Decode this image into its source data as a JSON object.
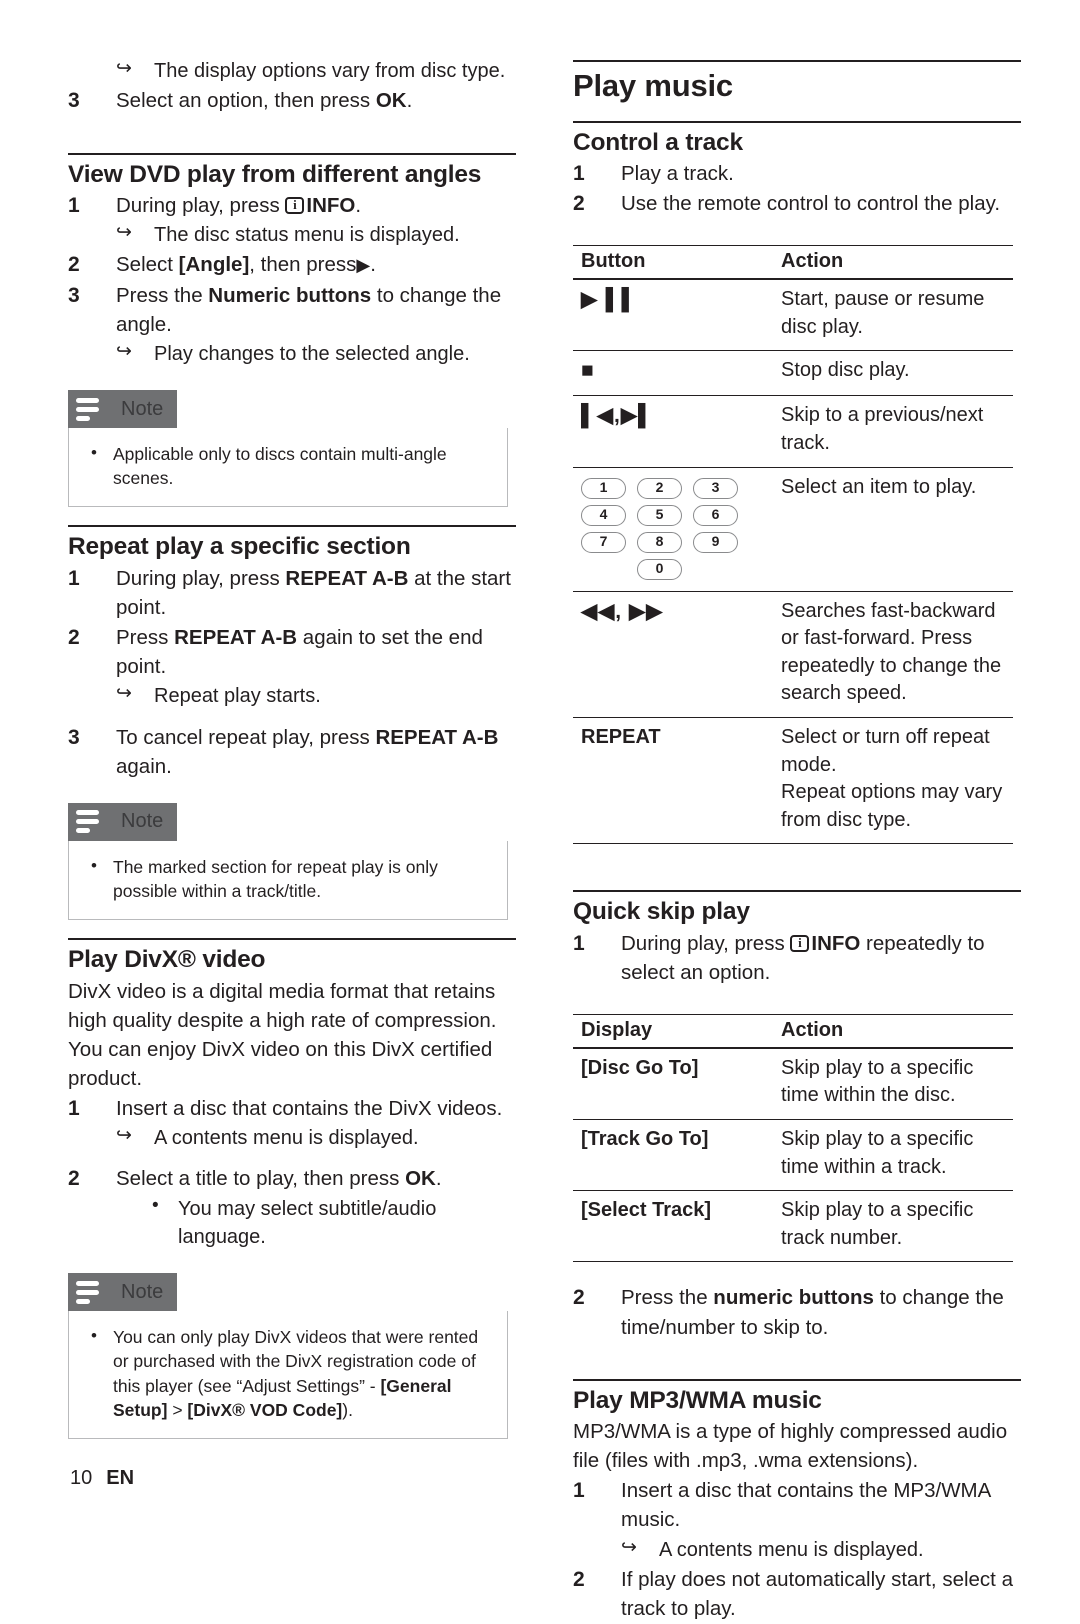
{
  "page": {
    "number": "10",
    "language": "EN"
  },
  "left_column": {
    "carryover": {
      "arrow_note": "The display options vary from disc type.",
      "step3_num": "3",
      "step3_pre": "Select an option, then press ",
      "step3_bold": "OK",
      "step3_post": "."
    },
    "section_angles": {
      "heading": "View DVD play from different angles",
      "step1_num": "1",
      "step1_pre": "During play, press ",
      "step1_bold": "INFO",
      "step1_post": ".",
      "step1_arrow": "The disc status menu is displayed.",
      "step2_num": "2",
      "step2_pre": "Select ",
      "step2_bold": "[Angle]",
      "step2_post": ", then press",
      "step2_glyph": "▶",
      "step2_end": ".",
      "step3_num": "3",
      "step3_pre": "Press the ",
      "step3_bold": "Numeric buttons",
      "step3_post": " to change the angle.",
      "step3_arrow": "Play changes to the selected angle."
    },
    "note1": {
      "title": "Note",
      "items": [
        "Applicable only to discs contain multi-angle scenes."
      ]
    },
    "section_repeat": {
      "heading": "Repeat play a specific section",
      "step1_num": "1",
      "step1_pre": "During play, press ",
      "step1_bold": "REPEAT A-B",
      "step1_post": " at the start point.",
      "step2_num": "2",
      "step2_pre": "Press ",
      "step2_bold": "REPEAT A-B",
      "step2_post": " again to set the end point.",
      "step2_arrow": "Repeat play starts.",
      "step3_num": "3",
      "step3_pre": "To cancel repeat play, press ",
      "step3_bold": "REPEAT A-B",
      "step3_post": " again."
    },
    "note2": {
      "title": "Note",
      "items": [
        "The marked section for repeat play is only possible within a track/title."
      ]
    },
    "section_divx": {
      "heading": "Play DivX® video",
      "intro": "DivX video is a digital media format that retains high quality despite a high rate of compression. You can enjoy DivX video on this DivX certified product.",
      "step1_num": "1",
      "step1_text": "Insert a disc that contains the DivX videos.",
      "step1_arrow": "A contents menu is displayed.",
      "step2_num": "2",
      "step2_pre": "Select a title to play, then press ",
      "step2_bold": "OK",
      "step2_post": ".",
      "step2_bullet": "You may select subtitle/audio language."
    },
    "note3": {
      "title": "Note",
      "item_part1": "You can only play DivX videos that were rented or purchased with the DivX registration code of this player (see “Adjust Settings” - ",
      "item_bold1": "[General Setup]",
      "item_part2": " > ",
      "item_bold2": "[DivX® VOD Code]",
      "item_part3": ")."
    }
  },
  "right_column": {
    "title": "Play music",
    "section_control": {
      "heading": "Control a track",
      "step1_num": "1",
      "step1_text": "Play a track.",
      "step2_num": "2",
      "step2_text": "Use the remote control to control the play."
    },
    "button_table": {
      "headers": [
        "Button",
        "Action"
      ],
      "rows": [
        {
          "button_glyph": "▶▐▐",
          "button_name": "play-pause-icon",
          "action": "Start, pause or resume disc play."
        },
        {
          "button_glyph": "■",
          "button_name": "stop-icon",
          "action": "Stop disc play."
        },
        {
          "button_glyph": "▌◀,▶▌",
          "button_name": "skip-prev-next-icon",
          "action": "Skip to a previous/next track."
        },
        {
          "button_glyph": "KEYPAD",
          "button_name": "numeric-buttons-icon",
          "action": "Select an item to play."
        },
        {
          "button_glyph": "◀◀, ▶▶",
          "button_name": "fast-rewind-forward-icon",
          "action": "Searches fast-backward or fast-forward. Press repeatedly to change the search speed."
        },
        {
          "button_glyph": "REPEAT",
          "button_name": "repeat-button-label",
          "action": "Select or turn off repeat mode.\nRepeat options may vary from disc type."
        }
      ],
      "keypad_keys": [
        "1",
        "2",
        "3",
        "4",
        "5",
        "6",
        "7",
        "8",
        "9",
        "0"
      ]
    },
    "section_quickskip": {
      "heading": "Quick skip play",
      "step1_num": "1",
      "step1_pre": "During play, press ",
      "step1_bold": "INFO",
      "step1_post": " repeatedly to select an option.",
      "step2_num": "2",
      "step2_pre": "Press the ",
      "step2_bold": "numeric buttons",
      "step2_post": " to change the time/number to skip to."
    },
    "display_table": {
      "headers": [
        "Display",
        "Action"
      ],
      "rows": [
        {
          "display": "[Disc Go To]",
          "action": "Skip play to a specific time within the disc."
        },
        {
          "display": "[Track Go To]",
          "action": "Skip play to a specific time within a track."
        },
        {
          "display": "[Select Track]",
          "action": "Skip play to a specific track number."
        }
      ]
    },
    "section_mp3": {
      "heading": "Play MP3/WMA music",
      "intro": "MP3/WMA is a type of highly compressed audio file (files with .mp3, .wma extensions).",
      "step1_num": "1",
      "step1_text": "Insert a disc that contains the MP3/WMA music.",
      "step1_arrow": "A contents menu is displayed.",
      "step2_num": "2",
      "step2_text": "If play does not automatically start, select a track to play."
    }
  }
}
